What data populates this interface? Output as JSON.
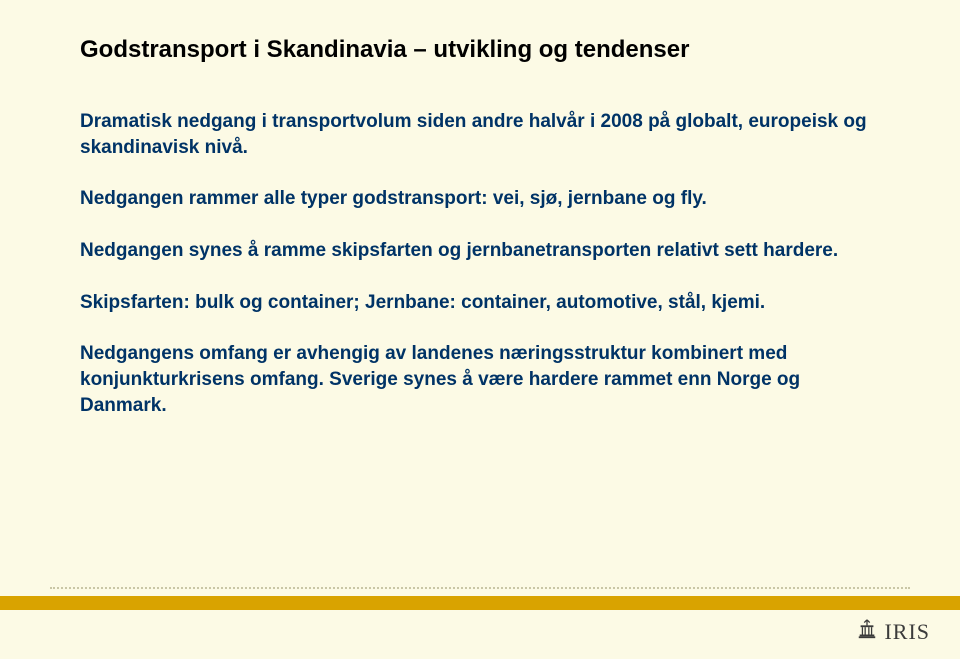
{
  "title": "Godstransport i Skandinavia – utvikling og tendenser",
  "paragraphs": {
    "p1": "Dramatisk nedgang i transportvolum siden andre halvår i 2008 på globalt, europeisk og skandinavisk nivå.",
    "p2": "Nedgangen rammer alle typer godstransport: vei, sjø, jernbane og fly.",
    "p3": "Nedgangen synes å ramme skipsfarten og jernbanetransporten relativt sett hardere.",
    "p4": "Skipsfarten: bulk og container; Jernbane: container, automotive, stål, kjemi.",
    "p5": "Nedgangens omfang er avhengig av landenes næringsstruktur kombinert med konjunkturkrisens omfang. Sverige synes å være hardere rammet enn Norge og Danmark."
  },
  "footer": {
    "logo_text": "IRIS"
  }
}
